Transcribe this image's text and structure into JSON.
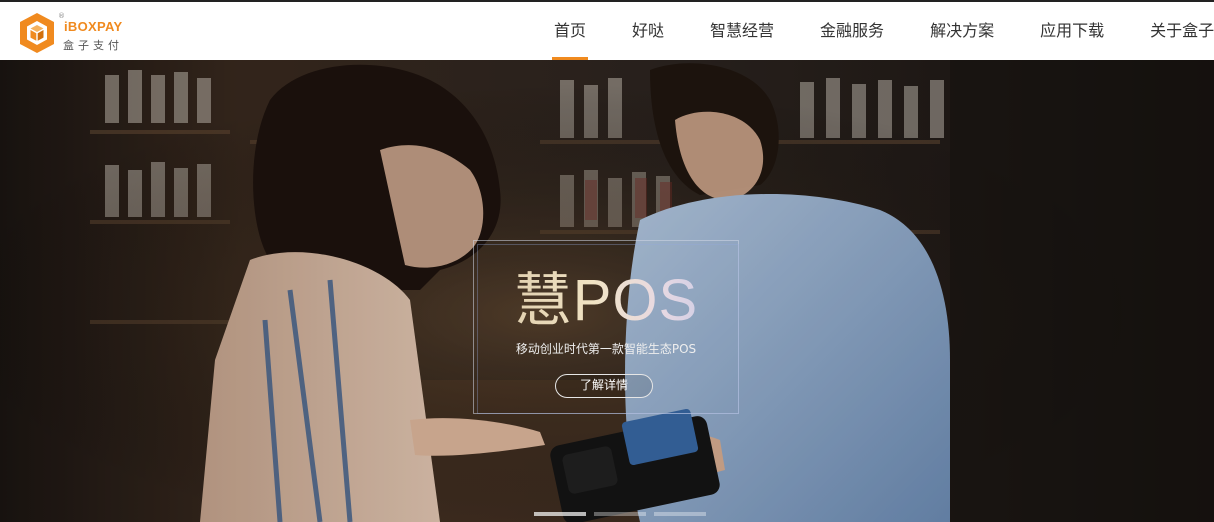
{
  "brand": {
    "en": "iBOXPAY",
    "cn": "盒子支付",
    "reg": "®"
  },
  "nav": {
    "items": [
      {
        "label": "首页",
        "active": true
      },
      {
        "label": "好哒",
        "active": false
      },
      {
        "label": "智慧经营",
        "active": false
      },
      {
        "label": "金融服务",
        "active": false
      },
      {
        "label": "解决方案",
        "active": false
      },
      {
        "label": "应用下载",
        "active": false
      },
      {
        "label": "关于盒子",
        "active": false
      }
    ]
  },
  "hero": {
    "title": "慧POS",
    "subtitle": "移动创业时代第一款智能生态POS",
    "cta": "了解详情",
    "slides": 3,
    "active_slide": 1
  },
  "colors": {
    "accent": "#f08a1f",
    "nav_text": "#333333"
  }
}
